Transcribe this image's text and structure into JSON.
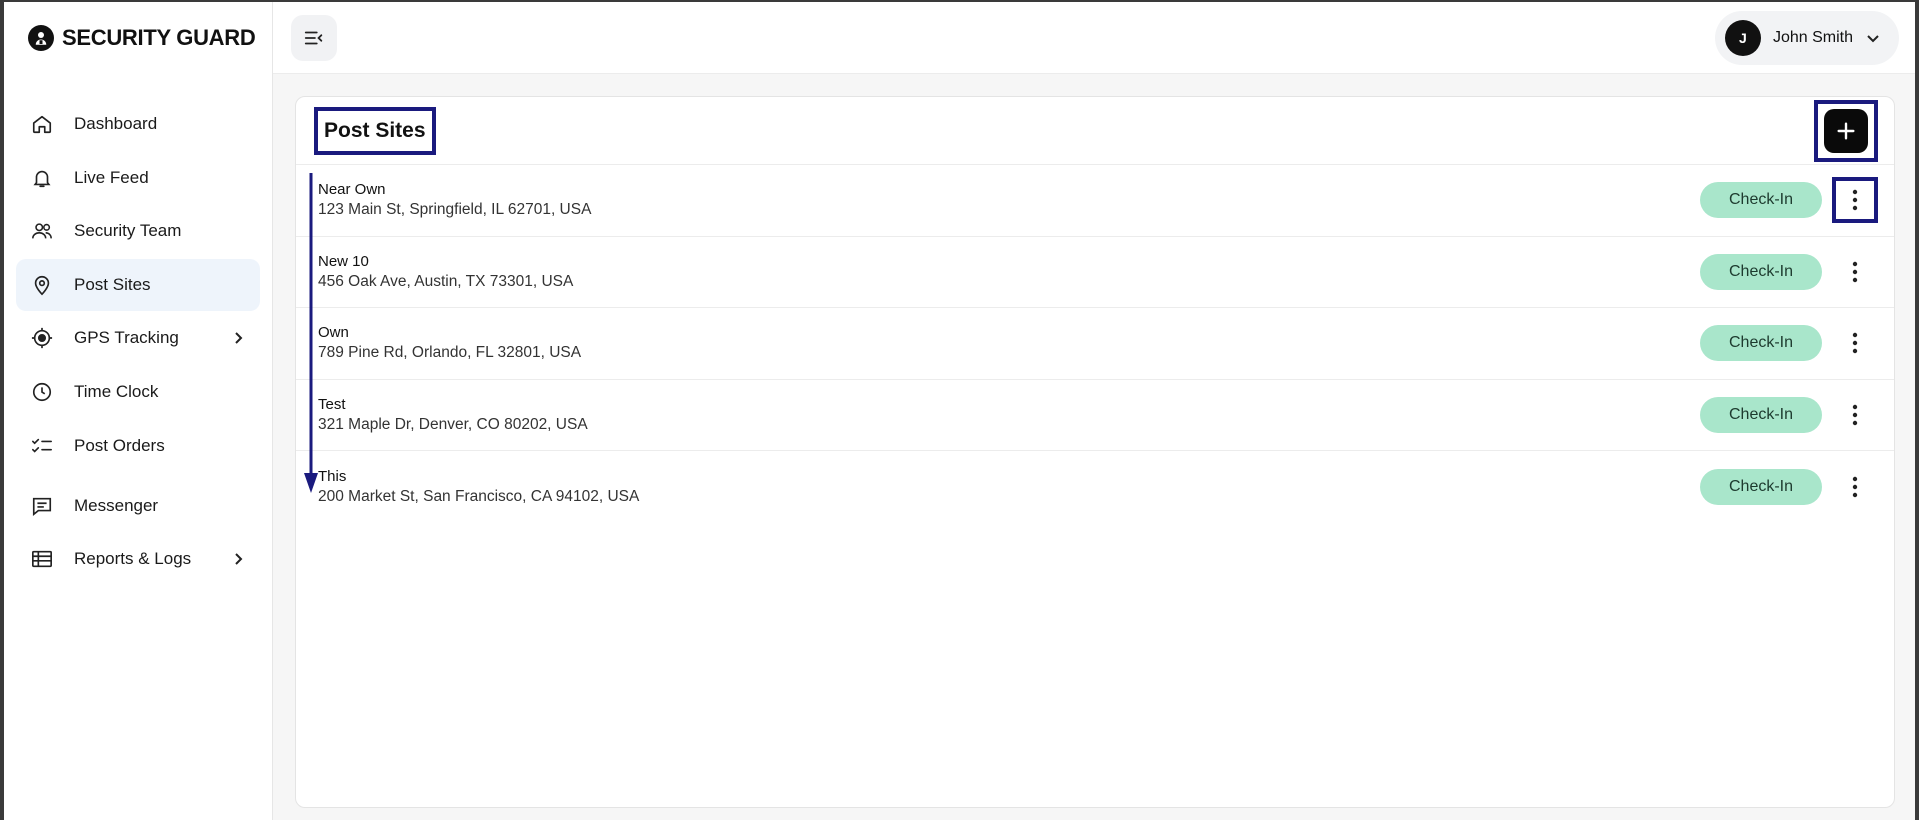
{
  "brand": {
    "name": "SECURITY GUARD",
    "logo_icon": "guard-badge-icon"
  },
  "sidebar": {
    "items": [
      {
        "label": "Dashboard",
        "icon": "home-icon",
        "active": false,
        "has_submenu": false
      },
      {
        "label": "Live Feed",
        "icon": "bell-icon",
        "active": false,
        "has_submenu": false
      },
      {
        "label": "Security Team",
        "icon": "users-icon",
        "active": false,
        "has_submenu": false
      },
      {
        "label": "Post Sites",
        "icon": "map-pin-icon",
        "active": true,
        "has_submenu": false
      },
      {
        "label": "GPS Tracking",
        "icon": "gps-icon",
        "active": false,
        "has_submenu": true
      },
      {
        "label": "Time Clock",
        "icon": "clock-icon",
        "active": false,
        "has_submenu": false
      },
      {
        "label": "Post Orders",
        "icon": "checklist-icon",
        "active": false,
        "has_submenu": false
      },
      {
        "label": "Messenger",
        "icon": "message-icon",
        "active": false,
        "has_submenu": false
      },
      {
        "label": "Reports & Logs",
        "icon": "table-icon",
        "active": false,
        "has_submenu": true
      }
    ]
  },
  "topbar": {
    "toggle_icon": "menu-collapse-icon",
    "user": {
      "initial": "J",
      "name": "John Smith",
      "dropdown_icon": "chevron-down-icon"
    }
  },
  "main": {
    "title": "Post Sites",
    "add_icon": "plus-icon",
    "checkin_label": "Check-In",
    "sites": [
      {
        "name": "Near Own",
        "address": "123 Main St, Springfield, IL 62701, USA"
      },
      {
        "name": "New 10",
        "address": "456 Oak Ave, Austin, TX 73301, USA"
      },
      {
        "name": "Own",
        "address": "789 Pine Rd, Orlando, FL 32801, USA"
      },
      {
        "name": "Test",
        "address": "321 Maple Dr, Denver, CO 80202, USA"
      },
      {
        "name": "This",
        "address": "200 Market St, San Francisco, CA 94102, USA"
      }
    ]
  },
  "colors": {
    "accent_active_bg": "#eef4fb",
    "checkin_bg": "#a9e6cb",
    "annotation": "#1a1a7e",
    "primary_button": "#0a0a0a"
  }
}
